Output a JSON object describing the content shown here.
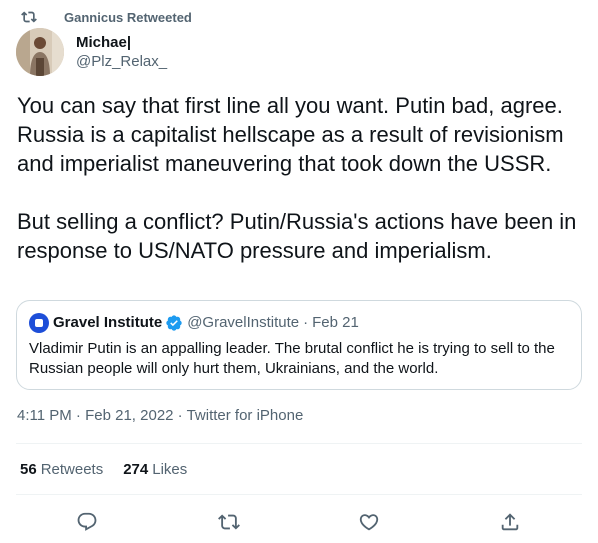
{
  "retweet_banner": {
    "text": "Gannicus Retweeted"
  },
  "author": {
    "display_name": "Michae|",
    "handle": "@Plz_Relax_"
  },
  "tweet": {
    "paragraphs": [
      "You can say that first line all you want. Putin bad, agree. Russia is a capitalist hellscape as a result of revisionism and imperialist maneuvering that took down the USSR.",
      "But selling a conflict? Putin/Russia's actions have been in response to US/NATO pressure and imperialism."
    ]
  },
  "quote": {
    "name": "Gravel Institute",
    "handle": "@GravelInstitute",
    "separator": "·",
    "date": "Feb 21",
    "text": "Vladimir Putin is an appalling leader. The brutal conflict he is trying to sell to the Russian people will only hurt them, Ukrainians, and the world."
  },
  "meta": {
    "time": "4:11 PM",
    "separator": "·",
    "date": "Feb 21, 2022",
    "source": "Twitter for iPhone"
  },
  "stats": {
    "retweets_count": "56",
    "retweets_label": "Retweets",
    "likes_count": "274",
    "likes_label": "Likes"
  },
  "icons": {
    "retweet_banner": "retweet-icon",
    "verified": "verified-badge-icon",
    "reply": "reply-icon",
    "retweet": "retweet-icon",
    "like": "heart-icon",
    "share": "share-icon"
  },
  "colors": {
    "secondary_text": "#536471",
    "verified_blue": "#1d9bf0",
    "border": "#cfd9de"
  }
}
